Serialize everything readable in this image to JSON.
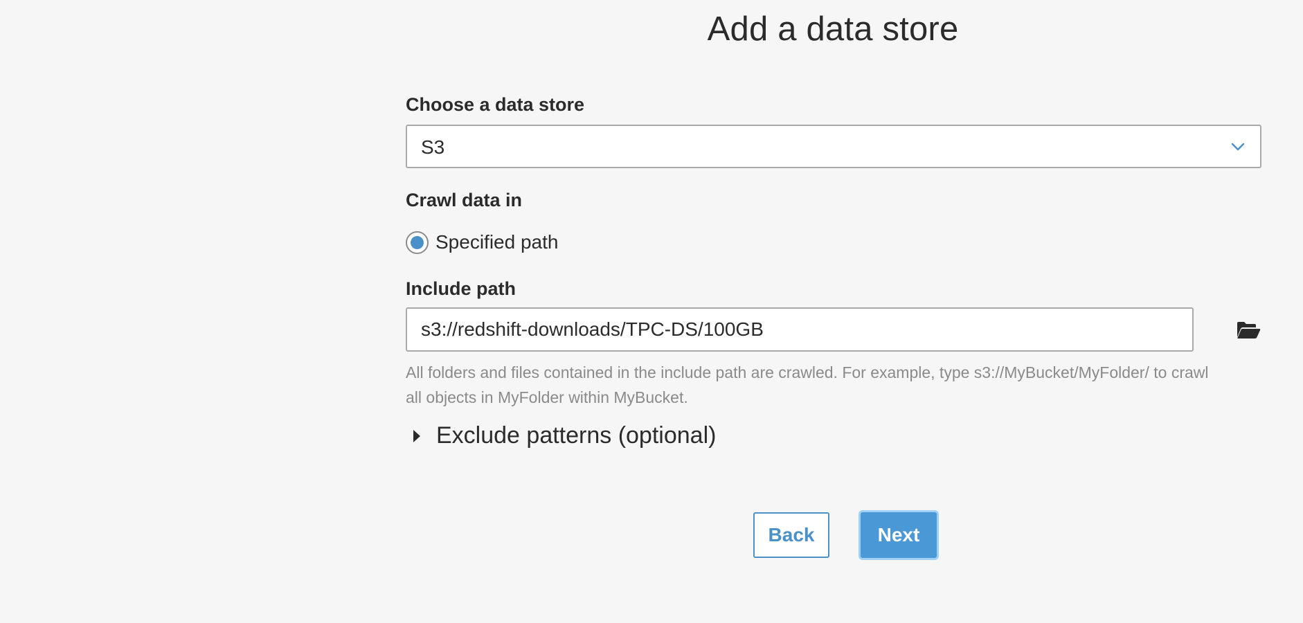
{
  "page": {
    "title": "Add a data store"
  },
  "data_store": {
    "label": "Choose a data store",
    "selected": "S3"
  },
  "crawl": {
    "label": "Crawl data in",
    "option_label": "Specified path",
    "option_selected": true
  },
  "include_path": {
    "label": "Include path",
    "value": "s3://redshift-downloads/TPC-DS/100GB",
    "help_line1": "All folders and files contained in the include path are crawled. For example, type s3://MyBucket/MyFolder/ to crawl",
    "help_line2": "all objects in MyFolder within MyBucket."
  },
  "exclude": {
    "label": "Exclude patterns (optional)"
  },
  "buttons": {
    "back": "Back",
    "next": "Next"
  },
  "icons": {
    "dropdown": "chevron-down-icon",
    "browse": "folder-open-icon",
    "expander": "caret-right-icon"
  },
  "colors": {
    "accent": "#4a90c9",
    "primary_button": "#4a98d6",
    "background": "#f5f6f5"
  }
}
